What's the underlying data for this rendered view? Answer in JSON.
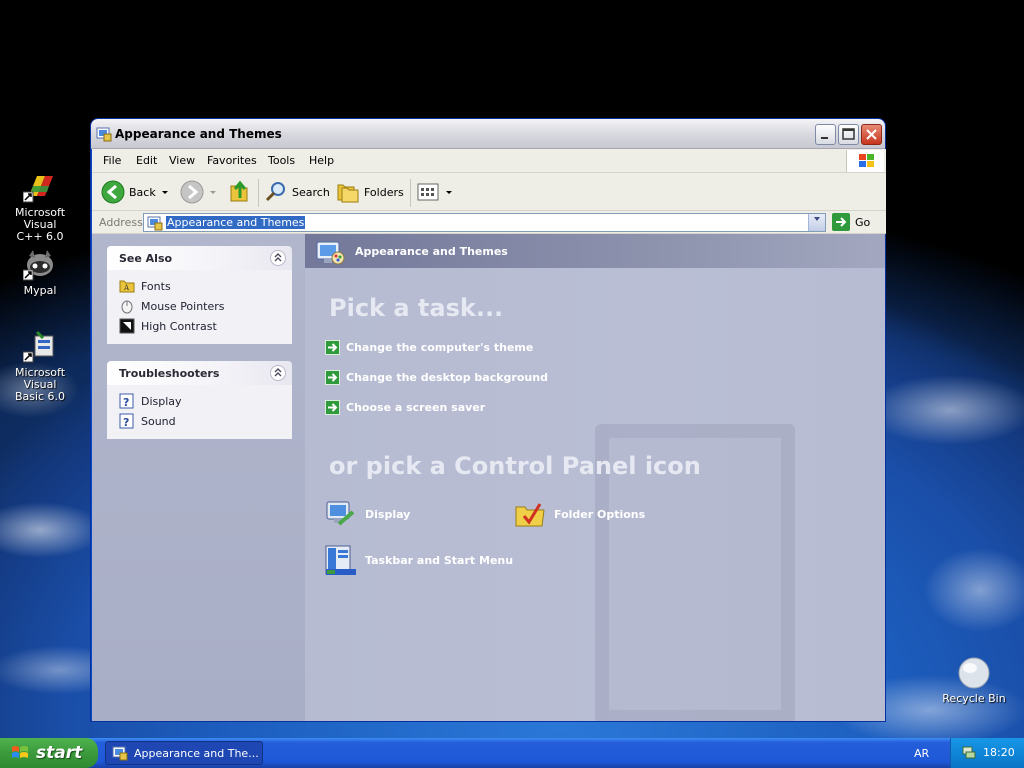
{
  "desktop": {
    "icons": [
      {
        "label_line1": "Microsoft Visual",
        "label_line2": "C++ 6.0",
        "icon": "vc6-icon"
      },
      {
        "label_line1": "Mypal",
        "label_line2": "",
        "icon": "mypal-icon"
      },
      {
        "label_line1": "Microsoft Visual",
        "label_line2": "Basic 6.0",
        "icon": "vb6-icon"
      },
      {
        "label_line1": "Recycle Bin",
        "label_line2": "",
        "icon": "recycle-bin-icon"
      }
    ]
  },
  "window": {
    "title": "Appearance and Themes",
    "menu": [
      "File",
      "Edit",
      "View",
      "Favorites",
      "Tools",
      "Help"
    ],
    "toolbar": {
      "back_label": "Back",
      "search_label": "Search",
      "folders_label": "Folders"
    },
    "address": {
      "label": "Address",
      "value": "Appearance and Themes",
      "go_label": "Go"
    }
  },
  "left_pane": {
    "see_also": {
      "title": "See Also",
      "items": [
        "Fonts",
        "Mouse Pointers",
        "High Contrast"
      ]
    },
    "troubleshooters": {
      "title": "Troubleshooters",
      "items": [
        "Display",
        "Sound"
      ]
    }
  },
  "right_pane": {
    "header": "Appearance and Themes",
    "pick_task": "Pick a task...",
    "tasks": [
      "Change the computer's theme",
      "Change the desktop background",
      "Choose a screen saver"
    ],
    "pick_icon": "or pick a Control Panel icon",
    "icons": [
      "Display",
      "Folder Options",
      "Taskbar and Start Menu"
    ]
  },
  "taskbar": {
    "start_label": "start",
    "task_item": "Appearance and The...",
    "language": "AR",
    "clock": "18:20"
  },
  "colors": {
    "accent_blue": "#245edb",
    "start_green": "#3c9a3c",
    "task_arrow_green": "#2f9a3b",
    "highlight": "#316ac5"
  }
}
